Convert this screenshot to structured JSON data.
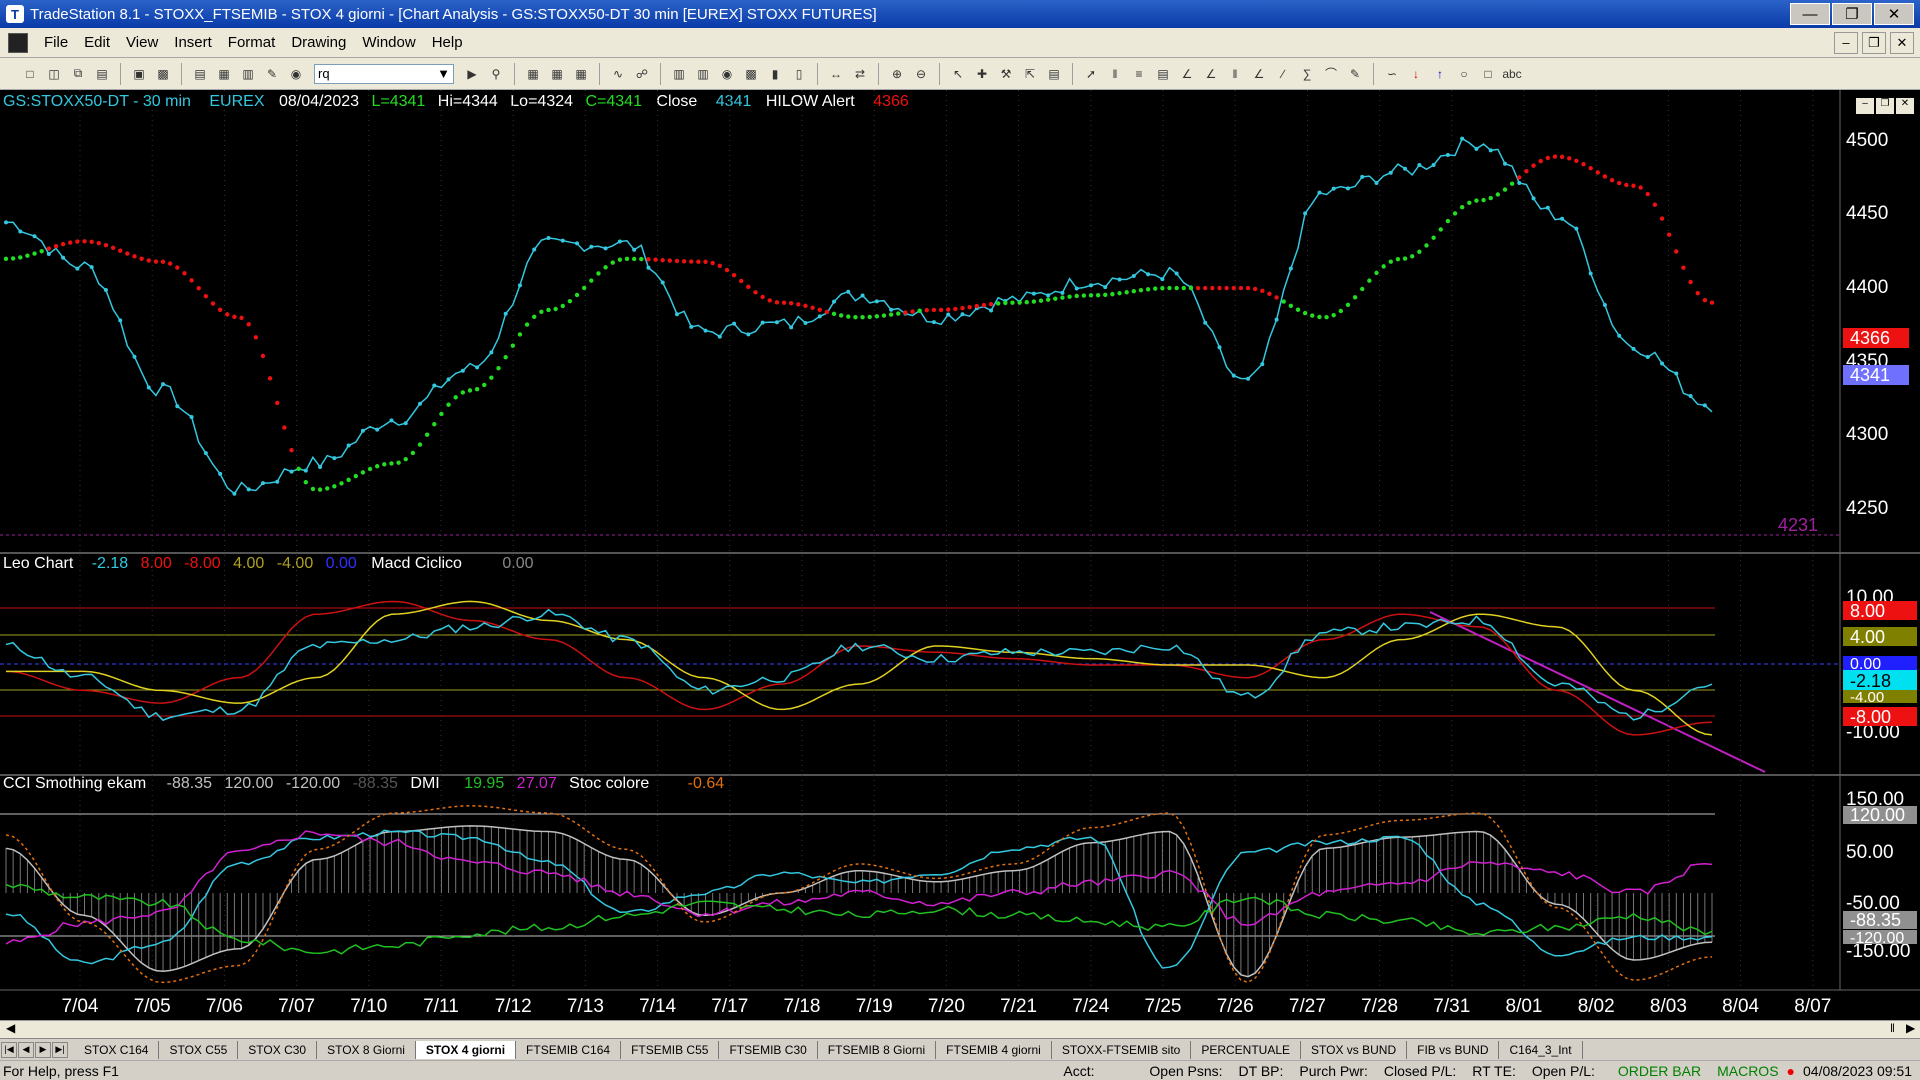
{
  "window": {
    "title": "TradeStation 8.1 - STOXX_FTSEMIB - STOX 4 giorni - [Chart Analysis - GS:STOXX50-DT  30 min  [EUREX] STOXX FUTURES]",
    "app_icon": "tradestation-icon"
  },
  "menu": [
    "File",
    "Edit",
    "View",
    "Insert",
    "Format",
    "Drawing",
    "Window",
    "Help"
  ],
  "toolbar": {
    "combo_value": "rq"
  },
  "chart_header": {
    "symbol": "GS:STOXX50-DT - 30 min",
    "exchange": "EUREX",
    "date": "08/04/2023",
    "last": "L=4341",
    "hi": "Hi=4344",
    "lo": "Lo=4324",
    "close_val": "C=4341",
    "study1": "Close",
    "study1_val": "4341",
    "study2": "HILOW Alert",
    "study2_val": "4366",
    "level_label": "4231"
  },
  "price_axis": {
    "ticks": [
      "4500",
      "4450",
      "4400",
      "4350",
      "4300",
      "4250"
    ],
    "badge_red": "4366",
    "badge_blue": "4341"
  },
  "panel2": {
    "name": "Leo Chart",
    "values": [
      "-2.18",
      "8.00",
      "-8.00",
      "4.00",
      "-4.00",
      "0.00"
    ],
    "name2": "Macd Ciclico",
    "value2": "0.00",
    "axis_ticks": [
      "10.00",
      "-10.00"
    ],
    "badges": [
      "8.00",
      "4.00",
      "0.00",
      "-2.18",
      "-4.00",
      "-8.00"
    ]
  },
  "panel3": {
    "name": "CCI Smothing ekam",
    "values": [
      "-88.35",
      "120.00",
      "-120.00",
      "-88.35"
    ],
    "name2": "DMI",
    "dmi_values": [
      "19.95",
      "27.07"
    ],
    "name3": "Stoc colore",
    "value3": "-0.64",
    "axis_ticks": [
      "150.00",
      "50.00",
      "-50.00",
      "-150.00"
    ],
    "badges": [
      "120.00",
      "-88.35",
      "-120.00"
    ]
  },
  "date_axis": [
    "7/04",
    "7/05",
    "7/06",
    "7/07",
    "7/10",
    "7/11",
    "7/12",
    "7/13",
    "7/14",
    "7/17",
    "7/18",
    "7/19",
    "7/20",
    "7/21",
    "7/24",
    "7/25",
    "7/26",
    "7/27",
    "7/28",
    "7/31",
    "8/01",
    "8/02",
    "8/03",
    "8/04",
    "8/07"
  ],
  "tabs": [
    "STOX C164",
    "STOX C55",
    "STOX  C30",
    "STOX  8 Giorni",
    "STOX 4 giorni",
    "FTSEMIB C164",
    "FTSEMIB C55",
    "FTSEMIB C30",
    "FTSEMIB  8 Giorni",
    "FTSEMIB  4 giorni",
    "STOXX-FTSEMIB sito",
    "PERCENTUALE",
    "STOX vs BUND",
    "FIB vs BUND",
    "C164_3_Int"
  ],
  "active_tab": "STOX 4 giorni",
  "status": {
    "help": "For Help, press F1",
    "fields": [
      "Acct:",
      "Open Psns:",
      "DT BP:",
      "Purch Pwr:",
      "Closed P/L:",
      "RT TE:",
      "Open P/L:"
    ],
    "order_bar": "ORDER BAR",
    "macros": "MACROS",
    "datetime": "04/08/2023 09:51"
  },
  "colors": {
    "price": "#33c8e0",
    "ma_up": "#22dd22",
    "ma_down": "#ee1111",
    "macd_red": "#cc1111",
    "macd_yellow": "#e0d020",
    "cci_gray": "#c0c0c0",
    "dmi_magenta": "#d020d0",
    "dmi_green": "#20c020",
    "stoc_orange": "#e07010"
  },
  "chart_data": [
    {
      "type": "line",
      "title": "GS:STOXX50-DT - 30 min",
      "ylim": [
        4231,
        4515
      ],
      "x": [
        "7/04",
        "7/05",
        "7/06",
        "7/07",
        "7/10",
        "7/11",
        "7/12",
        "7/13",
        "7/14",
        "7/17",
        "7/18",
        "7/19",
        "7/20",
        "7/21",
        "7/24",
        "7/25",
        "7/26",
        "7/27",
        "7/28",
        "7/31",
        "8/01",
        "8/02",
        "8/03"
      ],
      "series": [
        {
          "name": "Close",
          "values": [
            4445,
            4415,
            4330,
            4262,
            4280,
            4310,
            4345,
            4430,
            4430,
            4370,
            4375,
            4395,
            4380,
            4392,
            4405,
            4410,
            4335,
            4465,
            4480,
            4500,
            4450,
            4360,
            4320
          ]
        },
        {
          "name": "HILOW Alert",
          "values": [
            4420,
            4432,
            4418,
            4380,
            4262,
            4280,
            4330,
            4385,
            4420,
            4418,
            4390,
            4380,
            4385,
            4390,
            4395,
            4400,
            4400,
            4380,
            4420,
            4460,
            4490,
            4470,
            4390
          ]
        }
      ]
    },
    {
      "type": "line",
      "title": "Macd Ciclico",
      "ylim": [
        -14,
        14
      ],
      "x": [
        "7/04",
        "7/05",
        "7/06",
        "7/07",
        "7/10",
        "7/11",
        "7/12",
        "7/13",
        "7/14",
        "7/17",
        "7/18",
        "7/19",
        "7/20",
        "7/21",
        "7/24",
        "7/25",
        "7/26",
        "7/27",
        "7/28",
        "7/31",
        "8/01",
        "8/02",
        "8/03"
      ],
      "series": [
        {
          "name": "Leo Chart",
          "values": [
            3,
            -2,
            -8,
            -7,
            3,
            4,
            6,
            8,
            4,
            -4,
            -2,
            3,
            1,
            2,
            2,
            3,
            -5,
            5,
            6,
            7,
            -3,
            -8,
            -3
          ]
        },
        {
          "name": "Macd Ciclico",
          "values": [
            -1,
            -4,
            -6,
            -2,
            8,
            10,
            7,
            4,
            -2,
            -7,
            -3,
            3,
            2,
            1,
            0,
            0,
            -2,
            4,
            8,
            6,
            -4,
            -11,
            -9
          ]
        }
      ]
    },
    {
      "type": "line",
      "title": "CCI Smothing ekam",
      "ylim": [
        -170,
        170
      ],
      "x": [
        "7/04",
        "7/05",
        "7/06",
        "7/07",
        "7/10",
        "7/11",
        "7/12",
        "7/13",
        "7/14",
        "7/17",
        "7/18",
        "7/19",
        "7/20",
        "7/21",
        "7/24",
        "7/25",
        "7/26",
        "7/27",
        "7/28",
        "7/31",
        "8/01",
        "8/02",
        "8/03"
      ],
      "series": [
        {
          "name": "CCI Smothing ekam",
          "values": [
            80,
            -40,
            -140,
            -100,
            60,
            110,
            120,
            110,
            60,
            -40,
            0,
            40,
            20,
            40,
            90,
            110,
            -150,
            80,
            100,
            110,
            -20,
            -120,
            -88
          ]
        },
        {
          "name": "DMI",
          "values": [
            19,
            21,
            22,
            28,
            30,
            29,
            27,
            26,
            24,
            22,
            23,
            24,
            23,
            24,
            25,
            26,
            21,
            24,
            25,
            27,
            26,
            24,
            27
          ]
        }
      ]
    }
  ]
}
